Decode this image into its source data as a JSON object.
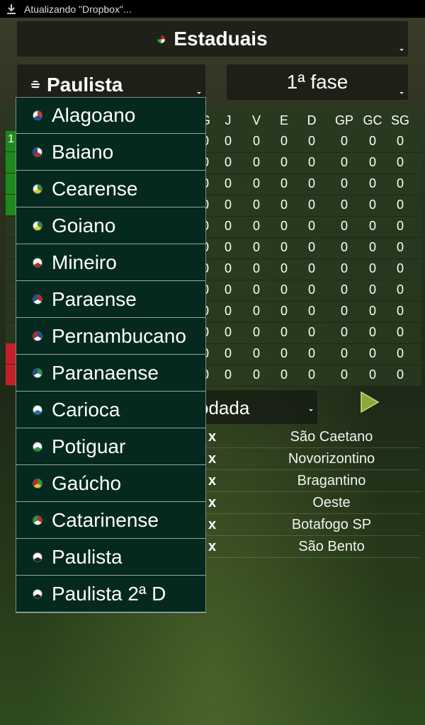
{
  "status_bar": {
    "notification": "Atualizando \"Dropbox\"..."
  },
  "selectors": {
    "championship_group": "Estaduais",
    "championship": "Paulista",
    "phase": "1ª fase"
  },
  "standings": {
    "columns": [
      "G",
      "J",
      "V",
      "E",
      "D",
      "GP",
      "GC",
      "SG"
    ],
    "rows": [
      {
        "pos": "1",
        "zone": "green",
        "values": [
          "0",
          "0",
          "0",
          "0",
          "0",
          "0",
          "0",
          "0"
        ]
      },
      {
        "pos": "",
        "zone": "green",
        "values": [
          "0",
          "0",
          "0",
          "0",
          "0",
          "0",
          "0",
          "0"
        ]
      },
      {
        "pos": "",
        "zone": "green",
        "values": [
          "0",
          "0",
          "0",
          "0",
          "0",
          "0",
          "0",
          "0"
        ]
      },
      {
        "pos": "",
        "zone": "green",
        "values": [
          "0",
          "0",
          "0",
          "0",
          "0",
          "0",
          "0",
          "0"
        ]
      },
      {
        "pos": "",
        "zone": "none",
        "values": [
          "0",
          "0",
          "0",
          "0",
          "0",
          "0",
          "0",
          "0"
        ]
      },
      {
        "pos": "",
        "zone": "none",
        "values": [
          "0",
          "0",
          "0",
          "0",
          "0",
          "0",
          "0",
          "0"
        ]
      },
      {
        "pos": "",
        "zone": "none",
        "values": [
          "0",
          "0",
          "0",
          "0",
          "0",
          "0",
          "0",
          "0"
        ]
      },
      {
        "pos": "",
        "zone": "none",
        "values": [
          "0",
          "0",
          "0",
          "0",
          "0",
          "0",
          "0",
          "0"
        ]
      },
      {
        "pos": "",
        "zone": "none",
        "values": [
          "0",
          "0",
          "0",
          "0",
          "0",
          "0",
          "0",
          "0"
        ]
      },
      {
        "pos": "",
        "zone": "none",
        "values": [
          "0",
          "0",
          "0",
          "0",
          "0",
          "0",
          "0",
          "0"
        ]
      },
      {
        "pos": "",
        "zone": "red",
        "values": [
          "0",
          "0",
          "0",
          "0",
          "0",
          "0",
          "0",
          "0"
        ]
      },
      {
        "pos": "",
        "zone": "red",
        "values": [
          "0",
          "0",
          "0",
          "0",
          "0",
          "0",
          "0",
          "0"
        ]
      }
    ]
  },
  "round": {
    "label": "odada"
  },
  "matches": [
    {
      "separator": "x",
      "team": "São Caetano"
    },
    {
      "separator": "x",
      "team": "Novorizontino"
    },
    {
      "separator": "x",
      "team": "Bragantino"
    },
    {
      "separator": "x",
      "team": "Oeste"
    },
    {
      "separator": "x",
      "team": "Botafogo SP"
    },
    {
      "separator": "x",
      "team": "São Bento"
    }
  ],
  "dropdown": {
    "items": [
      {
        "label": "Alagoano",
        "icon": "alagoas-flag-icon",
        "colors": [
          "#d33",
          "#1a4fa8",
          "#fff"
        ]
      },
      {
        "label": "Baiano",
        "icon": "bahia-flag-icon",
        "colors": [
          "#fff",
          "#c22",
          "#1a4fa8"
        ]
      },
      {
        "label": "Cearense",
        "icon": "ceara-flag-icon",
        "colors": [
          "#2a9a3a",
          "#e8c52a",
          "#fff"
        ]
      },
      {
        "label": "Goiano",
        "icon": "goias-flag-icon",
        "colors": [
          "#2a9a3a",
          "#e8d52a",
          "#fff"
        ]
      },
      {
        "label": "Mineiro",
        "icon": "minas-flag-icon",
        "colors": [
          "#fff",
          "#c22",
          "#fff"
        ]
      },
      {
        "label": "Paraense",
        "icon": "para-flag-icon",
        "colors": [
          "#c22",
          "#fff",
          "#1a4fa8"
        ]
      },
      {
        "label": "Pernambucano",
        "icon": "pernambuco-flag-icon",
        "colors": [
          "#1a4fa8",
          "#fff",
          "#c22"
        ]
      },
      {
        "label": "Paranaense",
        "icon": "parana-flag-icon",
        "colors": [
          "#2a9a3a",
          "#fff",
          "#1a4fa8"
        ]
      },
      {
        "label": "Carioca",
        "icon": "rio-flag-icon",
        "colors": [
          "#fff",
          "#1a6fc8",
          "#fff"
        ]
      },
      {
        "label": "Potiguar",
        "icon": "rn-flag-icon",
        "colors": [
          "#fff",
          "#2a9a3a",
          "#fff"
        ]
      },
      {
        "label": "Gaúcho",
        "icon": "rs-flag-icon",
        "colors": [
          "#2a9a3a",
          "#e8c52a",
          "#c22"
        ]
      },
      {
        "label": "Catarinense",
        "icon": "sc-flag-icon",
        "colors": [
          "#c22",
          "#fff",
          "#2a9a3a"
        ]
      },
      {
        "label": "Paulista",
        "icon": "sp-flag-icon",
        "colors": [
          "#fff",
          "#222",
          "#fff"
        ]
      },
      {
        "label": "Paulista 2ª D",
        "icon": "sp-flag-icon",
        "colors": [
          "#fff",
          "#222",
          "#fff"
        ]
      }
    ]
  },
  "colors": {
    "zone_green": "#1e8a1e",
    "zone_red": "#c4202a",
    "dropdown_bg": "#05291f"
  }
}
